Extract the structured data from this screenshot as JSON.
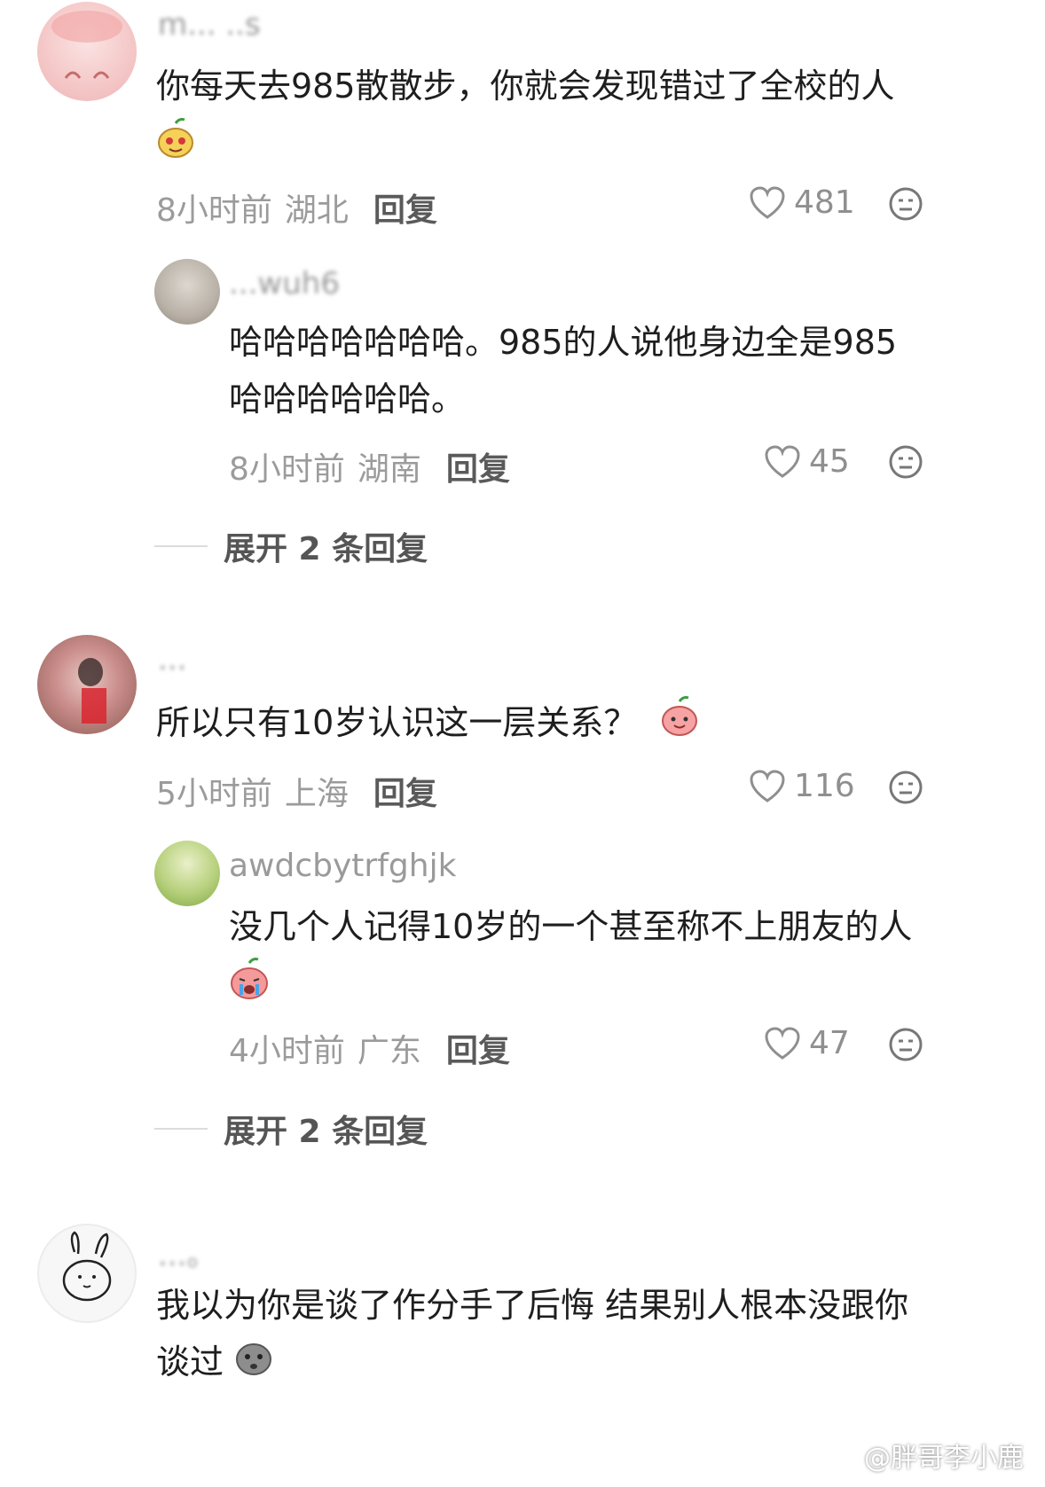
{
  "comments": [
    {
      "username": "m... ..s",
      "text": "你每天去985散散步，你就会发现错过了全校的人",
      "time": "8小时前",
      "location": "湖北",
      "reply_label": "回复",
      "likes": "481",
      "emoji": "pear-smile-emoji",
      "replies": [
        {
          "username": "...wuh6",
          "text_line1": "哈哈哈哈哈哈哈。985的人说他身边全是985",
          "text_line2": "哈哈哈哈哈哈。",
          "time": "8小时前",
          "location": "湖南",
          "reply_label": "回复",
          "likes": "45"
        }
      ],
      "expand_label": "展开 2 条回复"
    },
    {
      "username": "...",
      "text": "所以只有10岁认识这一层关系？",
      "time": "5小时前",
      "location": "上海",
      "reply_label": "回复",
      "likes": "116",
      "emoji": "peach-smile-emoji",
      "replies": [
        {
          "username": "awdcbytrfghjk",
          "text": "没几个人记得10岁的一个甚至称不上朋友的人",
          "time": "4小时前",
          "location": "广东",
          "reply_label": "回复",
          "likes": "47",
          "emoji": "peach-crying-emoji"
        }
      ],
      "expand_label": "展开 2 条回复"
    },
    {
      "username": "...。",
      "text_line1": "我以为你是谈了作分手了后悔 结果别人根本没跟你",
      "text_line2": "谈过",
      "emoji": "gray-speechless-emoji"
    }
  ],
  "watermark": "@胖哥李小鹿",
  "colors": {
    "meta_gray": "#9b9b9b",
    "text": "#1e1e1e",
    "reply": "#5a5a5a"
  }
}
